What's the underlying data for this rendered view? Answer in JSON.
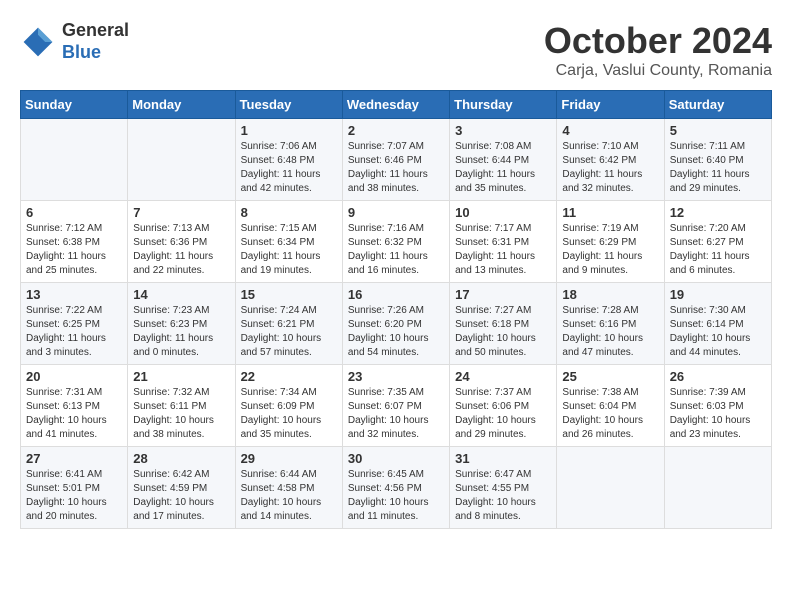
{
  "logo": {
    "general": "General",
    "blue": "Blue"
  },
  "header": {
    "month": "October 2024",
    "location": "Carja, Vaslui County, Romania"
  },
  "days_of_week": [
    "Sunday",
    "Monday",
    "Tuesday",
    "Wednesday",
    "Thursday",
    "Friday",
    "Saturday"
  ],
  "weeks": [
    [
      {
        "day": "",
        "info": ""
      },
      {
        "day": "",
        "info": ""
      },
      {
        "day": "1",
        "info": "Sunrise: 7:06 AM\nSunset: 6:48 PM\nDaylight: 11 hours and 42 minutes."
      },
      {
        "day": "2",
        "info": "Sunrise: 7:07 AM\nSunset: 6:46 PM\nDaylight: 11 hours and 38 minutes."
      },
      {
        "day": "3",
        "info": "Sunrise: 7:08 AM\nSunset: 6:44 PM\nDaylight: 11 hours and 35 minutes."
      },
      {
        "day": "4",
        "info": "Sunrise: 7:10 AM\nSunset: 6:42 PM\nDaylight: 11 hours and 32 minutes."
      },
      {
        "day": "5",
        "info": "Sunrise: 7:11 AM\nSunset: 6:40 PM\nDaylight: 11 hours and 29 minutes."
      }
    ],
    [
      {
        "day": "6",
        "info": "Sunrise: 7:12 AM\nSunset: 6:38 PM\nDaylight: 11 hours and 25 minutes."
      },
      {
        "day": "7",
        "info": "Sunrise: 7:13 AM\nSunset: 6:36 PM\nDaylight: 11 hours and 22 minutes."
      },
      {
        "day": "8",
        "info": "Sunrise: 7:15 AM\nSunset: 6:34 PM\nDaylight: 11 hours and 19 minutes."
      },
      {
        "day": "9",
        "info": "Sunrise: 7:16 AM\nSunset: 6:32 PM\nDaylight: 11 hours and 16 minutes."
      },
      {
        "day": "10",
        "info": "Sunrise: 7:17 AM\nSunset: 6:31 PM\nDaylight: 11 hours and 13 minutes."
      },
      {
        "day": "11",
        "info": "Sunrise: 7:19 AM\nSunset: 6:29 PM\nDaylight: 11 hours and 9 minutes."
      },
      {
        "day": "12",
        "info": "Sunrise: 7:20 AM\nSunset: 6:27 PM\nDaylight: 11 hours and 6 minutes."
      }
    ],
    [
      {
        "day": "13",
        "info": "Sunrise: 7:22 AM\nSunset: 6:25 PM\nDaylight: 11 hours and 3 minutes."
      },
      {
        "day": "14",
        "info": "Sunrise: 7:23 AM\nSunset: 6:23 PM\nDaylight: 11 hours and 0 minutes."
      },
      {
        "day": "15",
        "info": "Sunrise: 7:24 AM\nSunset: 6:21 PM\nDaylight: 10 hours and 57 minutes."
      },
      {
        "day": "16",
        "info": "Sunrise: 7:26 AM\nSunset: 6:20 PM\nDaylight: 10 hours and 54 minutes."
      },
      {
        "day": "17",
        "info": "Sunrise: 7:27 AM\nSunset: 6:18 PM\nDaylight: 10 hours and 50 minutes."
      },
      {
        "day": "18",
        "info": "Sunrise: 7:28 AM\nSunset: 6:16 PM\nDaylight: 10 hours and 47 minutes."
      },
      {
        "day": "19",
        "info": "Sunrise: 7:30 AM\nSunset: 6:14 PM\nDaylight: 10 hours and 44 minutes."
      }
    ],
    [
      {
        "day": "20",
        "info": "Sunrise: 7:31 AM\nSunset: 6:13 PM\nDaylight: 10 hours and 41 minutes."
      },
      {
        "day": "21",
        "info": "Sunrise: 7:32 AM\nSunset: 6:11 PM\nDaylight: 10 hours and 38 minutes."
      },
      {
        "day": "22",
        "info": "Sunrise: 7:34 AM\nSunset: 6:09 PM\nDaylight: 10 hours and 35 minutes."
      },
      {
        "day": "23",
        "info": "Sunrise: 7:35 AM\nSunset: 6:07 PM\nDaylight: 10 hours and 32 minutes."
      },
      {
        "day": "24",
        "info": "Sunrise: 7:37 AM\nSunset: 6:06 PM\nDaylight: 10 hours and 29 minutes."
      },
      {
        "day": "25",
        "info": "Sunrise: 7:38 AM\nSunset: 6:04 PM\nDaylight: 10 hours and 26 minutes."
      },
      {
        "day": "26",
        "info": "Sunrise: 7:39 AM\nSunset: 6:03 PM\nDaylight: 10 hours and 23 minutes."
      }
    ],
    [
      {
        "day": "27",
        "info": "Sunrise: 6:41 AM\nSunset: 5:01 PM\nDaylight: 10 hours and 20 minutes."
      },
      {
        "day": "28",
        "info": "Sunrise: 6:42 AM\nSunset: 4:59 PM\nDaylight: 10 hours and 17 minutes."
      },
      {
        "day": "29",
        "info": "Sunrise: 6:44 AM\nSunset: 4:58 PM\nDaylight: 10 hours and 14 minutes."
      },
      {
        "day": "30",
        "info": "Sunrise: 6:45 AM\nSunset: 4:56 PM\nDaylight: 10 hours and 11 minutes."
      },
      {
        "day": "31",
        "info": "Sunrise: 6:47 AM\nSunset: 4:55 PM\nDaylight: 10 hours and 8 minutes."
      },
      {
        "day": "",
        "info": ""
      },
      {
        "day": "",
        "info": ""
      }
    ]
  ]
}
